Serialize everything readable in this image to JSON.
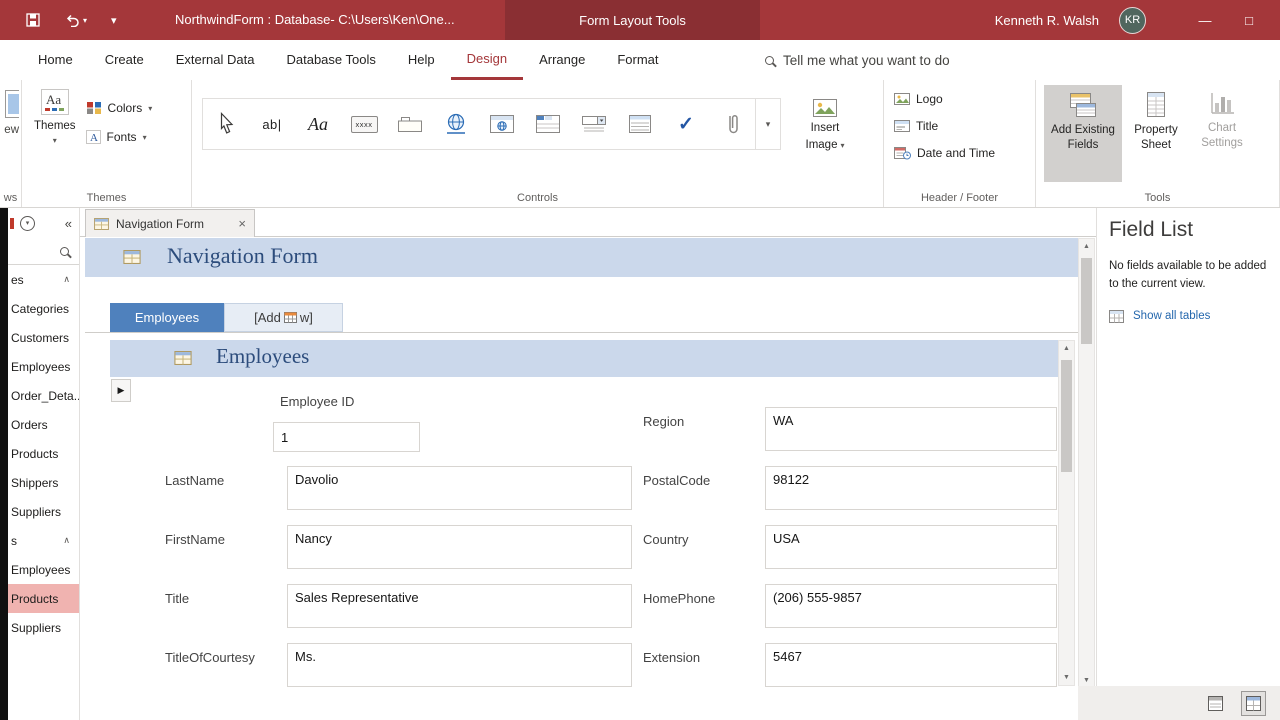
{
  "colors": {
    "brand": "#a4373a",
    "brand_dark": "#8a2f33",
    "band": "#cbd8eb",
    "form_title": "#2c4c7c",
    "nav_tab_blue": "#4f81bd",
    "selected_rose": "#f0b3b0",
    "link": "#2467ad"
  },
  "icons": {
    "dropdown": "▾",
    "minimize": "—",
    "maximize": "□",
    "collapse": "«",
    "group_collapse": "∧",
    "close": "×",
    "scroll_up": "▲",
    "scroll_down": "▼",
    "record_arrow": "▶",
    "check": "✓",
    "text_box": "ab|",
    "label_control": "Aa",
    "button_control": "xxxx"
  },
  "titlebar": {
    "title": "NorthwindForm : Database- C:\\Users\\Ken\\One...",
    "contextual": "Form Layout Tools",
    "user": "Kenneth R. Walsh",
    "initials": "KR"
  },
  "ribbon": {
    "tabs": [
      {
        "label": "Home"
      },
      {
        "label": "Create"
      },
      {
        "label": "External Data"
      },
      {
        "label": "Database Tools"
      },
      {
        "label": "Help"
      },
      {
        "label": "Design"
      },
      {
        "label": "Arrange"
      },
      {
        "label": "Format"
      }
    ],
    "search_placeholder": "Tell me what you want to do",
    "views_partial": {
      "button": "ew",
      "label": "ws"
    },
    "themes": {
      "themes": "Themes",
      "colors": "Colors",
      "fonts": "Fonts",
      "label": "Themes"
    },
    "controls": {
      "insert_image_1": "Insert",
      "insert_image_2": "Image",
      "label": "Controls",
      "gallery_icons": [
        "select",
        "text-box",
        "label",
        "button",
        "tab-control",
        "hyperlink",
        "web-browser-control",
        "navigation-control",
        "combo-box",
        "list-box",
        "check-box",
        "attachment"
      ]
    },
    "header_footer": {
      "logo": "Logo",
      "title": "Title",
      "date_time": "Date and Time",
      "label": "Header / Footer"
    },
    "tools": {
      "add_existing_1": "Add Existing",
      "add_existing_2": "Fields",
      "property_1": "Property",
      "property_2": "Sheet",
      "chart_1": "Chart",
      "chart_2": "Settings",
      "label": "Tools"
    }
  },
  "navpane": {
    "group1": {
      "header": "es",
      "items": [
        "Categories",
        "Customers",
        "Employees",
        "Order_Deta...",
        "Orders",
        "Products",
        "Shippers",
        "Suppliers"
      ]
    },
    "group2": {
      "header": "s",
      "items": [
        "Employees",
        "Products",
        "Suppliers"
      ],
      "selected": "Products"
    }
  },
  "document": {
    "tab": "Navigation Form",
    "form_title": "Navigation Form",
    "nav_tabs": {
      "active": "Employees",
      "add_new_prefix": "[Add",
      "add_new_suffix": "w]"
    },
    "subform_title": "Employees",
    "left_fields": [
      {
        "label": "Employee ID",
        "value": "1"
      },
      {
        "label": "LastName",
        "value": "Davolio"
      },
      {
        "label": "FirstName",
        "value": "Nancy"
      },
      {
        "label": "Title",
        "value": "Sales Representative"
      },
      {
        "label": "TitleOfCourtesy",
        "value": "Ms."
      }
    ],
    "right_fields": [
      {
        "label": "Region",
        "value": "WA"
      },
      {
        "label": "PostalCode",
        "value": "98122"
      },
      {
        "label": "Country",
        "value": "USA"
      },
      {
        "label": "HomePhone",
        "value": "(206) 555-9857"
      },
      {
        "label": "Extension",
        "value": "5467"
      }
    ]
  },
  "field_list": {
    "title": "Field List",
    "message": "No fields available to be added to the current view.",
    "link": "Show all tables"
  }
}
